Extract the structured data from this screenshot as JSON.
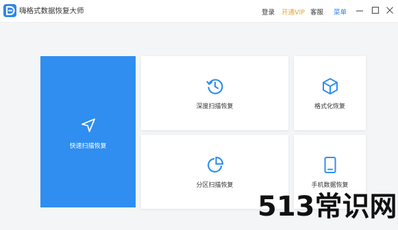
{
  "app": {
    "title": "嗨格式数据恢复大师"
  },
  "titlebar": {
    "login_label": "登录",
    "vip_label": "开通VIP",
    "service_label": "客服",
    "menu_label": "菜单"
  },
  "tiles": {
    "quick_scan": {
      "label": "快速扫描恢复",
      "icon": "navigation-arrow-icon"
    },
    "deep_scan": {
      "label": "深度扫描恢复",
      "icon": "history-clock-icon"
    },
    "format_recovery": {
      "label": "格式化恢复",
      "icon": "cube-icon"
    },
    "partition_scan": {
      "label": "分区扫描恢复",
      "icon": "pie-chart-icon"
    },
    "phone_recovery": {
      "label": "手机数据恢复",
      "icon": "tablet-icon"
    }
  },
  "watermark": {
    "text": "513常识网"
  },
  "colors": {
    "accent": "#2f8ef0",
    "vip": "#e6a23c",
    "link": "#2e86e8"
  }
}
